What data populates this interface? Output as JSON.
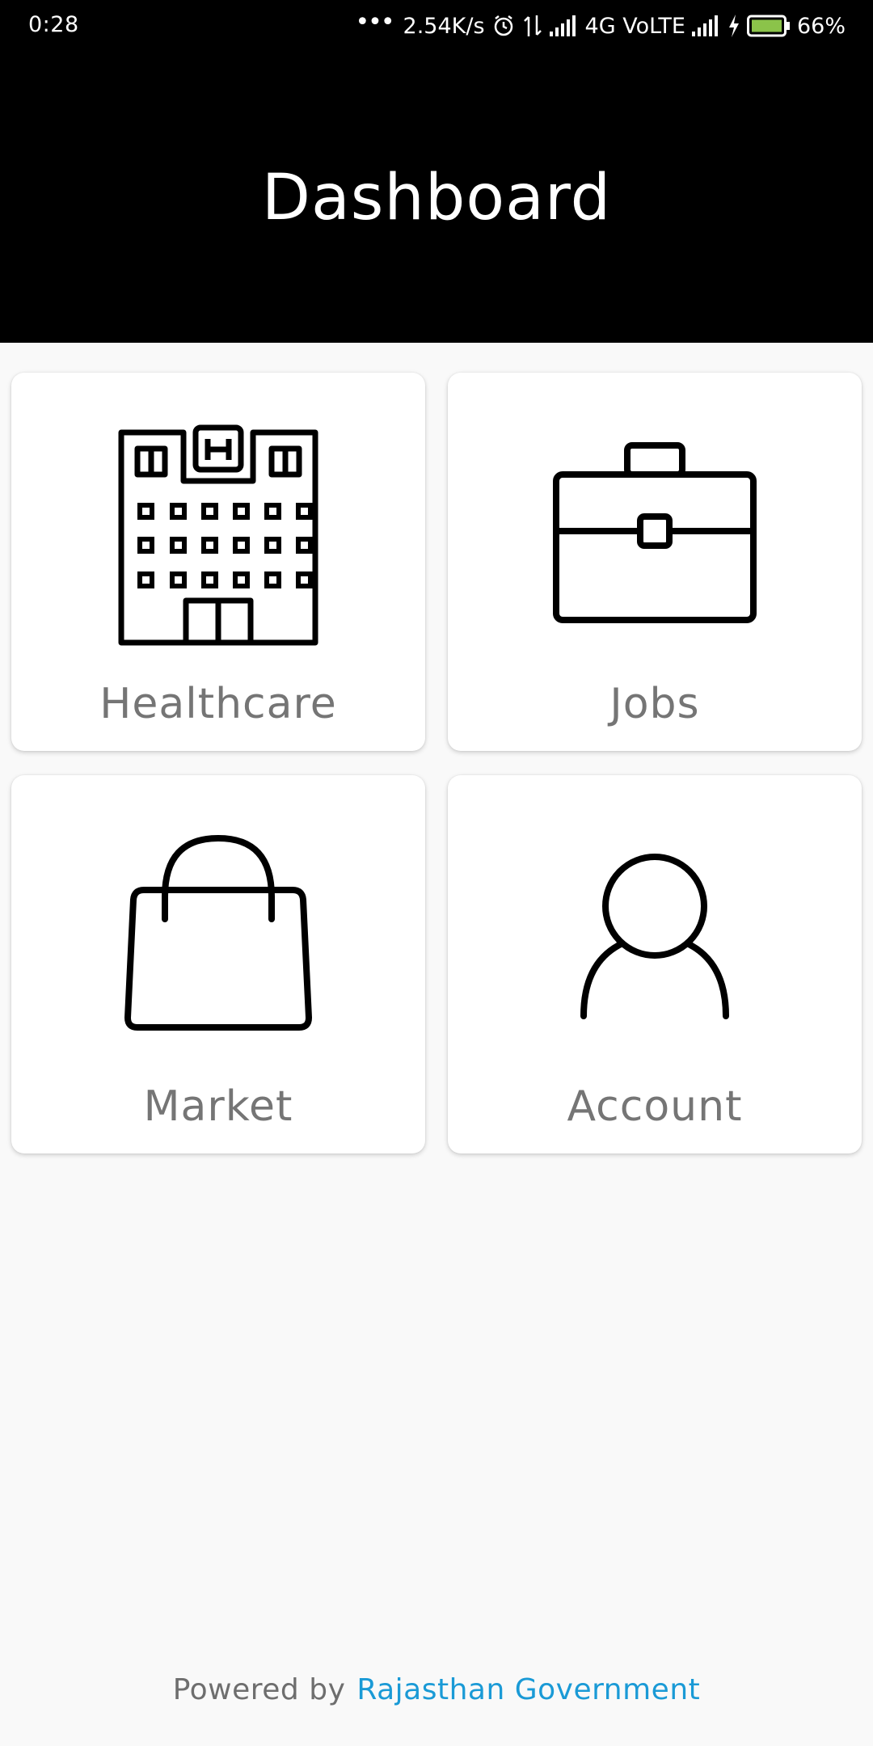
{
  "status_bar": {
    "time": "0:28",
    "network_speed": "2.54K/s",
    "network_type": "4G VoLTE",
    "battery": "66%",
    "icons": [
      "more-dots-icon",
      "alarm-icon",
      "data-transfer-icon",
      "signal-icon",
      "signal-icon-2",
      "charging-icon",
      "battery-icon"
    ],
    "battery_color": "#8bc34a"
  },
  "header": {
    "title": "Dashboard",
    "background": "#000000"
  },
  "tiles": [
    {
      "label": "Healthcare",
      "icon": "hospital-icon"
    },
    {
      "label": "Jobs",
      "icon": "briefcase-icon"
    },
    {
      "label": "Market",
      "icon": "shopping-bag-icon"
    },
    {
      "label": "Account",
      "icon": "user-icon"
    }
  ],
  "footer": {
    "prefix": "Powered by",
    "link_text": "Rajasthan Government",
    "link_color": "#1a9ad6"
  }
}
